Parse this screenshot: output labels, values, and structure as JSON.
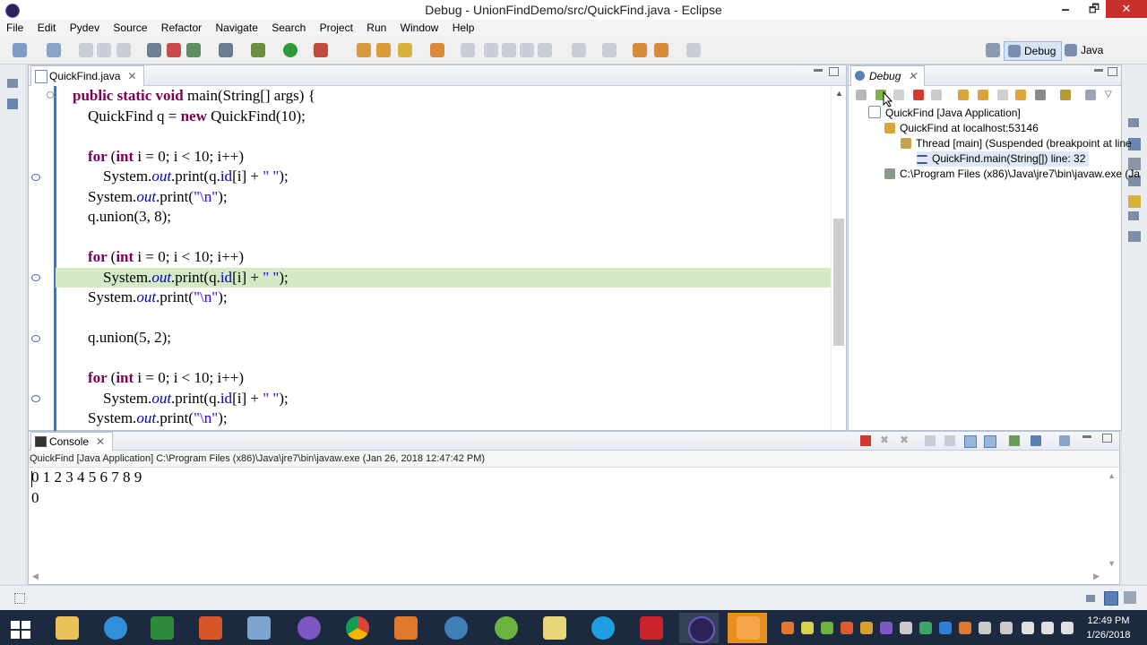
{
  "window": {
    "title": "Debug - UnionFindDemo/src/QuickFind.java - Eclipse",
    "min": "🗕",
    "max": "🗗",
    "close": "✕"
  },
  "menu": [
    "File",
    "Edit",
    "Pydev",
    "Source",
    "Refactor",
    "Navigate",
    "Search",
    "Project",
    "Run",
    "Window",
    "Help"
  ],
  "perspectives": {
    "debug": "Debug",
    "java": "Java"
  },
  "editor": {
    "tab": "QuickFind.java",
    "lines": [
      [
        [
          "kw",
          "public static void "
        ],
        [
          "",
          "main(String[] args) {"
        ]
      ],
      [
        [
          "",
          "    QuickFind q = "
        ],
        [
          "kw",
          "new "
        ],
        [
          "",
          "QuickFind(10);"
        ]
      ],
      [
        [
          "",
          ""
        ]
      ],
      [
        [
          "kw",
          "    for "
        ],
        [
          "",
          "("
        ],
        [
          "kw",
          "int "
        ],
        [
          "",
          "i = 0; i < 10; i++)"
        ]
      ],
      [
        [
          "",
          "        System."
        ],
        [
          "fld",
          "out"
        ],
        [
          "",
          ".print(q."
        ],
        [
          "fld2",
          "id"
        ],
        [
          "",
          "[i] + "
        ],
        [
          "str",
          "\" \""
        ],
        [
          "",
          ");"
        ]
      ],
      [
        [
          "",
          "    System."
        ],
        [
          "fld",
          "out"
        ],
        [
          "",
          ".print("
        ],
        [
          "str",
          "\"\\n\""
        ],
        [
          "",
          ");"
        ]
      ],
      [
        [
          "",
          "    q.union(3, 8);"
        ]
      ],
      [
        [
          "",
          ""
        ]
      ],
      [
        [
          "kw",
          "    for "
        ],
        [
          "",
          "("
        ],
        [
          "kw",
          "int "
        ],
        [
          "",
          "i = 0; i < 10; i++)"
        ]
      ],
      [
        [
          "",
          "        System."
        ],
        [
          "fld",
          "out"
        ],
        [
          "",
          ".print(q."
        ],
        [
          "fld2",
          "id"
        ],
        [
          "",
          "[i] + "
        ],
        [
          "str",
          "\" \""
        ],
        [
          "",
          ");"
        ]
      ],
      [
        [
          "",
          "    System."
        ],
        [
          "fld",
          "out"
        ],
        [
          "",
          ".print("
        ],
        [
          "str",
          "\"\\n\""
        ],
        [
          "",
          ");"
        ]
      ],
      [
        [
          "",
          ""
        ]
      ],
      [
        [
          "",
          "    q.union(5, 2);"
        ]
      ],
      [
        [
          "",
          ""
        ]
      ],
      [
        [
          "kw",
          "    for "
        ],
        [
          "",
          "("
        ],
        [
          "kw",
          "int "
        ],
        [
          "",
          "i = 0; i < 10; i++)"
        ]
      ],
      [
        [
          "",
          "        System."
        ],
        [
          "fld",
          "out"
        ],
        [
          "",
          ".print(q."
        ],
        [
          "fld2",
          "id"
        ],
        [
          "",
          "[i] + "
        ],
        [
          "str",
          "\" \""
        ],
        [
          "",
          ");"
        ]
      ],
      [
        [
          "",
          "    System."
        ],
        [
          "fld",
          "out"
        ],
        [
          "",
          ".print("
        ],
        [
          "str",
          "\"\\n\""
        ],
        [
          "",
          ");"
        ]
      ]
    ],
    "highlight_line": 9
  },
  "debug": {
    "tab": "Debug",
    "tree": [
      "QuickFind [Java Application]",
      "QuickFind at localhost:53146",
      "Thread [main] (Suspended (breakpoint at line",
      "QuickFind.main(String[]) line: 32",
      "C:\\Program Files (x86)\\Java\\jre7\\bin\\javaw.exe (Ja"
    ]
  },
  "console": {
    "tab": "Console",
    "description": "QuickFind [Java Application] C:\\Program Files (x86)\\Java\\jre7\\bin\\javaw.exe (Jan 26, 2018 12:47:42 PM)",
    "output": [
      "0 1 2 3 4 5 6 7 8 9",
      "0"
    ]
  },
  "taskbar": {
    "time": "12:49 PM",
    "date": "1/26/2018"
  },
  "colors": {
    "accent": "#4a72b0",
    "current_line": "#d4e9c6",
    "keyword": "#7f0055",
    "field": "#0000c0",
    "string": "#2a00ff"
  }
}
